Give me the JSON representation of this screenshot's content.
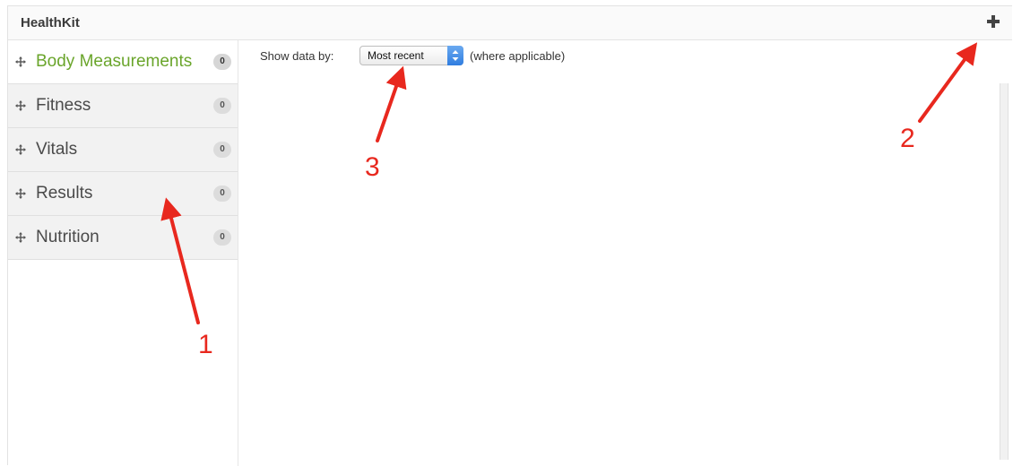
{
  "header": {
    "title": "HealthKit",
    "add_icon": "plus-icon"
  },
  "sidebar": {
    "items": [
      {
        "label": "Body Measurements",
        "count": "0",
        "active": true
      },
      {
        "label": "Fitness",
        "count": "0",
        "active": false
      },
      {
        "label": "Vitals",
        "count": "0",
        "active": false
      },
      {
        "label": "Results",
        "count": "0",
        "active": false
      },
      {
        "label": "Nutrition",
        "count": "0",
        "active": false
      }
    ],
    "item_icon": "move-icon"
  },
  "filter": {
    "label": "Show data by:",
    "selected": "Most recent",
    "note": "(where applicable)"
  },
  "annotations": {
    "callouts": [
      "1",
      "2",
      "3"
    ],
    "color": "#e8281e"
  },
  "colors": {
    "active_item_text": "#6aa52b",
    "select_arrow": "#2f7de0"
  }
}
